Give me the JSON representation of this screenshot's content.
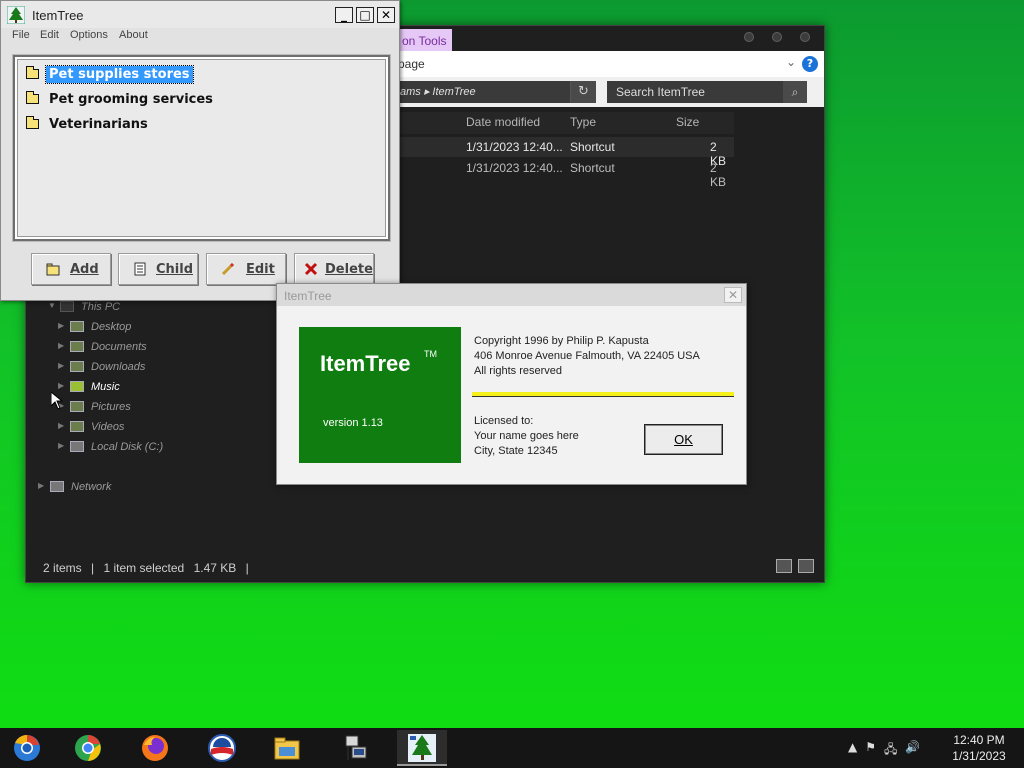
{
  "explorer": {
    "context_tab": "on Tools",
    "address_text": "page",
    "path_text": "ams ▸ ItemTree",
    "search_placeholder": "Search ItemTree",
    "columns": [
      "Date modified",
      "Type",
      "Size"
    ],
    "files": [
      {
        "date": "1/31/2023 12:40...",
        "type": "Shortcut",
        "size": "2 KB"
      },
      {
        "date": "1/31/2023 12:40...",
        "type": "Shortcut",
        "size": "2 KB"
      }
    ],
    "nav": {
      "this_pc": "This PC",
      "items": [
        "Desktop",
        "Documents",
        "Downloads",
        "Music",
        "Pictures",
        "Videos",
        "Local Disk (C:)"
      ],
      "network": "Network"
    },
    "status": {
      "items": "2 items",
      "selected": "1 item selected",
      "size": "1.47 KB"
    }
  },
  "itemtree": {
    "title": "ItemTree",
    "menu": [
      "File",
      "Edit",
      "Options",
      "About"
    ],
    "nodes": [
      {
        "label": "Pet supplies stores",
        "selected": true
      },
      {
        "label": "Pet grooming services",
        "selected": false
      },
      {
        "label": "Veterinarians",
        "selected": false
      }
    ],
    "buttons": {
      "add": "Add",
      "child": "Child",
      "edit": "Edit",
      "delete": "Delete"
    }
  },
  "about": {
    "title": "ItemTree",
    "close_glyph": "✕",
    "logo_name": "ItemTree",
    "logo_tm": "TM",
    "version": "version 1.13",
    "copyright": "Copyright 1996 by Philip P. Kapusta",
    "address": "406 Monroe Avenue  Falmouth, VA 22405  USA",
    "rights": "All rights reserved",
    "licensed_to": "Licensed to:",
    "license_name": "Your name goes here",
    "license_city": "City, State 12345",
    "ok": "OK"
  },
  "taskbar": {
    "apps": [
      "chromium-icon",
      "chrome-icon",
      "firefox-icon",
      "obama-logo-icon",
      "file-explorer-icon",
      "network-computer-icon",
      "itemtree-icon"
    ],
    "time": "12:40 PM",
    "date": "1/31/2023"
  },
  "colors": {
    "desktop": "#12c228",
    "selection": "#3399ff",
    "logo_green": "#0f7d0f",
    "about_line": "#f5ef1b"
  }
}
